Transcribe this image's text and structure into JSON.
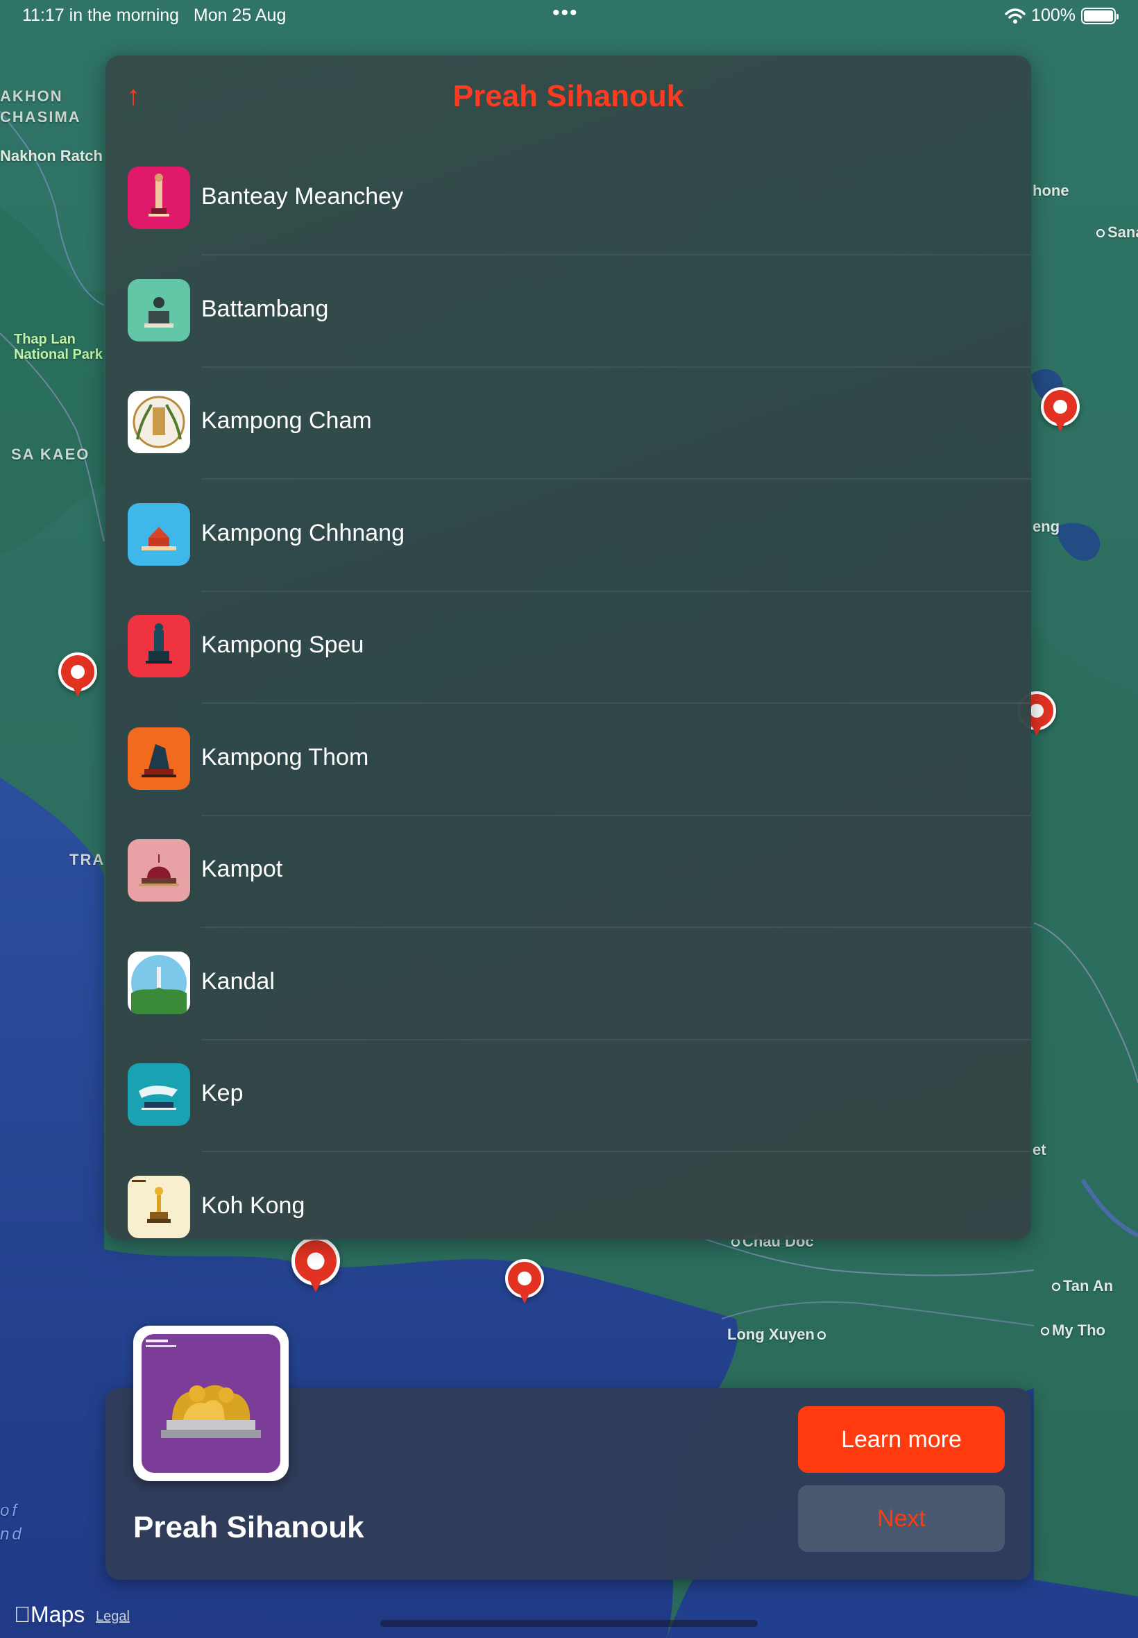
{
  "status_bar": {
    "time": "11:17 in the morning",
    "date": "Mon 25 Aug",
    "more_icon": "ellipsis-icon",
    "wifi_icon": "wifi-icon",
    "battery": "100%",
    "battery_level": 1.0
  },
  "map": {
    "labels": {
      "nakhon_ratchasima_1": "AKHON",
      "nakhon_ratchasima_2": "CHASIMA",
      "nakhon_ratch": "Nakhon Ratch",
      "thap_lan_1": "Thap Lan",
      "thap_lan_2": "National Park",
      "sa_kaeo": "SA KAEO",
      "trat": "TRA",
      "hone": "hone",
      "sana": "Sana",
      "eng": "eng",
      "et": "et",
      "chau_doc": "Chau Doc",
      "tan_an": "Tan An",
      "long_xuyen": "Long Xuyen",
      "my_tho": "My Tho",
      "gulf_1": "of",
      "gulf_2": "nd"
    },
    "pin_icon": "map-marker-icon"
  },
  "panel": {
    "back_icon": "arrow-up-icon",
    "back_arrow": "↑",
    "title": "Preah Sihanouk",
    "provinces": [
      {
        "name": "Banteay Meanchey",
        "color": "#e0196a"
      },
      {
        "name": "Battambang",
        "color": "#63c7a7"
      },
      {
        "name": "Kampong Cham",
        "color": "#ffffff"
      },
      {
        "name": "Kampong Chhnang",
        "color": "#3fb7ea"
      },
      {
        "name": "Kampong Speu",
        "color": "#ef3340"
      },
      {
        "name": "Kampong Thom",
        "color": "#f26a1e"
      },
      {
        "name": "Kampot",
        "color": "#e8a2a6"
      },
      {
        "name": "Kandal",
        "color": "#ffffff"
      },
      {
        "name": "Kep",
        "color": "#18a2b2"
      },
      {
        "name": "Koh Kong",
        "color": "#f7efce"
      }
    ]
  },
  "featured": {
    "name": "Preah Sihanouk",
    "icon": "golden-lions-statue-icon",
    "icon_color": "#7b3d98",
    "learn_more_label": "Learn more",
    "next_label": "Next"
  },
  "footer": {
    "maps_logo": "Maps",
    "legal": "Legal"
  },
  "colors": {
    "accent": "#ff3b1f",
    "land": "#2c6f63",
    "sea": "#23428f"
  }
}
